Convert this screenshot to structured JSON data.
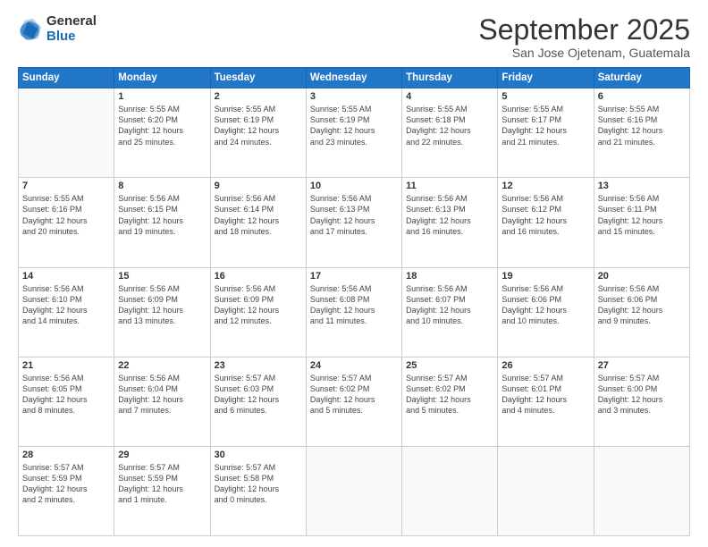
{
  "logo": {
    "general": "General",
    "blue": "Blue"
  },
  "header": {
    "month": "September 2025",
    "location": "San Jose Ojetenam, Guatemala"
  },
  "weekdays": [
    "Sunday",
    "Monday",
    "Tuesday",
    "Wednesday",
    "Thursday",
    "Friday",
    "Saturday"
  ],
  "weeks": [
    [
      {
        "day": "",
        "info": ""
      },
      {
        "day": "1",
        "info": "Sunrise: 5:55 AM\nSunset: 6:20 PM\nDaylight: 12 hours\nand 25 minutes."
      },
      {
        "day": "2",
        "info": "Sunrise: 5:55 AM\nSunset: 6:19 PM\nDaylight: 12 hours\nand 24 minutes."
      },
      {
        "day": "3",
        "info": "Sunrise: 5:55 AM\nSunset: 6:19 PM\nDaylight: 12 hours\nand 23 minutes."
      },
      {
        "day": "4",
        "info": "Sunrise: 5:55 AM\nSunset: 6:18 PM\nDaylight: 12 hours\nand 22 minutes."
      },
      {
        "day": "5",
        "info": "Sunrise: 5:55 AM\nSunset: 6:17 PM\nDaylight: 12 hours\nand 21 minutes."
      },
      {
        "day": "6",
        "info": "Sunrise: 5:55 AM\nSunset: 6:16 PM\nDaylight: 12 hours\nand 21 minutes."
      }
    ],
    [
      {
        "day": "7",
        "info": "Sunrise: 5:55 AM\nSunset: 6:16 PM\nDaylight: 12 hours\nand 20 minutes."
      },
      {
        "day": "8",
        "info": "Sunrise: 5:56 AM\nSunset: 6:15 PM\nDaylight: 12 hours\nand 19 minutes."
      },
      {
        "day": "9",
        "info": "Sunrise: 5:56 AM\nSunset: 6:14 PM\nDaylight: 12 hours\nand 18 minutes."
      },
      {
        "day": "10",
        "info": "Sunrise: 5:56 AM\nSunset: 6:13 PM\nDaylight: 12 hours\nand 17 minutes."
      },
      {
        "day": "11",
        "info": "Sunrise: 5:56 AM\nSunset: 6:13 PM\nDaylight: 12 hours\nand 16 minutes."
      },
      {
        "day": "12",
        "info": "Sunrise: 5:56 AM\nSunset: 6:12 PM\nDaylight: 12 hours\nand 16 minutes."
      },
      {
        "day": "13",
        "info": "Sunrise: 5:56 AM\nSunset: 6:11 PM\nDaylight: 12 hours\nand 15 minutes."
      }
    ],
    [
      {
        "day": "14",
        "info": "Sunrise: 5:56 AM\nSunset: 6:10 PM\nDaylight: 12 hours\nand 14 minutes."
      },
      {
        "day": "15",
        "info": "Sunrise: 5:56 AM\nSunset: 6:09 PM\nDaylight: 12 hours\nand 13 minutes."
      },
      {
        "day": "16",
        "info": "Sunrise: 5:56 AM\nSunset: 6:09 PM\nDaylight: 12 hours\nand 12 minutes."
      },
      {
        "day": "17",
        "info": "Sunrise: 5:56 AM\nSunset: 6:08 PM\nDaylight: 12 hours\nand 11 minutes."
      },
      {
        "day": "18",
        "info": "Sunrise: 5:56 AM\nSunset: 6:07 PM\nDaylight: 12 hours\nand 10 minutes."
      },
      {
        "day": "19",
        "info": "Sunrise: 5:56 AM\nSunset: 6:06 PM\nDaylight: 12 hours\nand 10 minutes."
      },
      {
        "day": "20",
        "info": "Sunrise: 5:56 AM\nSunset: 6:06 PM\nDaylight: 12 hours\nand 9 minutes."
      }
    ],
    [
      {
        "day": "21",
        "info": "Sunrise: 5:56 AM\nSunset: 6:05 PM\nDaylight: 12 hours\nand 8 minutes."
      },
      {
        "day": "22",
        "info": "Sunrise: 5:56 AM\nSunset: 6:04 PM\nDaylight: 12 hours\nand 7 minutes."
      },
      {
        "day": "23",
        "info": "Sunrise: 5:57 AM\nSunset: 6:03 PM\nDaylight: 12 hours\nand 6 minutes."
      },
      {
        "day": "24",
        "info": "Sunrise: 5:57 AM\nSunset: 6:02 PM\nDaylight: 12 hours\nand 5 minutes."
      },
      {
        "day": "25",
        "info": "Sunrise: 5:57 AM\nSunset: 6:02 PM\nDaylight: 12 hours\nand 5 minutes."
      },
      {
        "day": "26",
        "info": "Sunrise: 5:57 AM\nSunset: 6:01 PM\nDaylight: 12 hours\nand 4 minutes."
      },
      {
        "day": "27",
        "info": "Sunrise: 5:57 AM\nSunset: 6:00 PM\nDaylight: 12 hours\nand 3 minutes."
      }
    ],
    [
      {
        "day": "28",
        "info": "Sunrise: 5:57 AM\nSunset: 5:59 PM\nDaylight: 12 hours\nand 2 minutes."
      },
      {
        "day": "29",
        "info": "Sunrise: 5:57 AM\nSunset: 5:59 PM\nDaylight: 12 hours\nand 1 minute."
      },
      {
        "day": "30",
        "info": "Sunrise: 5:57 AM\nSunset: 5:58 PM\nDaylight: 12 hours\nand 0 minutes."
      },
      {
        "day": "",
        "info": ""
      },
      {
        "day": "",
        "info": ""
      },
      {
        "day": "",
        "info": ""
      },
      {
        "day": "",
        "info": ""
      }
    ]
  ]
}
